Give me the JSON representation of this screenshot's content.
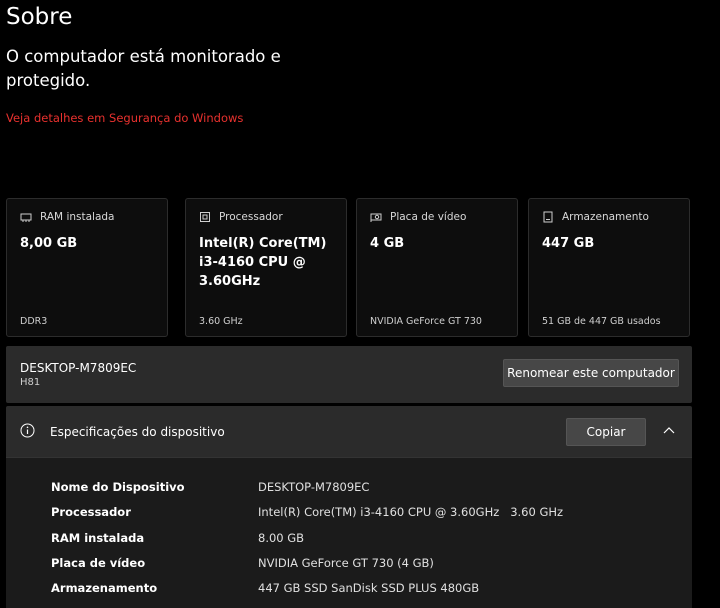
{
  "page": {
    "title": "Sobre",
    "status": "O computador está monitorado e protegido.",
    "security_link": "Veja detalhes em Segurança do Windows"
  },
  "cards": [
    {
      "label": "RAM instalada",
      "value": "8,00 GB",
      "sub": "DDR3",
      "icon": "ram-icon"
    },
    {
      "label": "Processador",
      "value": "Intel(R) Core(TM) i3-4160 CPU @ 3.60GHz",
      "sub": "3.60 GHz",
      "icon": "processor-icon"
    },
    {
      "label": "Placa de vídeo",
      "value": "4 GB",
      "sub": "NVIDIA GeForce GT 730",
      "icon": "gpu-icon"
    },
    {
      "label": "Armazenamento",
      "value": "447 GB",
      "sub": "51 GB de 447 GB usados",
      "icon": "storage-icon"
    }
  ],
  "device": {
    "name": "DESKTOP-M7809EC",
    "model": "H81",
    "rename_label": "Renomear este computador"
  },
  "specs": {
    "title": "Especificações do dispositivo",
    "copy_label": "Copiar",
    "rows": [
      {
        "key": "Nome do Dispositivo",
        "value": "DESKTOP-M7809EC"
      },
      {
        "key": "Processador",
        "value": "Intel(R) Core(TM) i3-4160 CPU @ 3.60GHz   3.60 GHz"
      },
      {
        "key": "RAM instalada",
        "value": "8.00 GB"
      },
      {
        "key": "Placa de vídeo",
        "value": "NVIDIA GeForce GT 730 (4 GB)"
      },
      {
        "key": "Armazenamento",
        "value": "447 GB SSD SanDisk SSD PLUS 480GB"
      }
    ]
  },
  "colors": {
    "background": "#000000",
    "link": "#e8312e",
    "panel": "#2b2b2b",
    "button": "#474747"
  }
}
